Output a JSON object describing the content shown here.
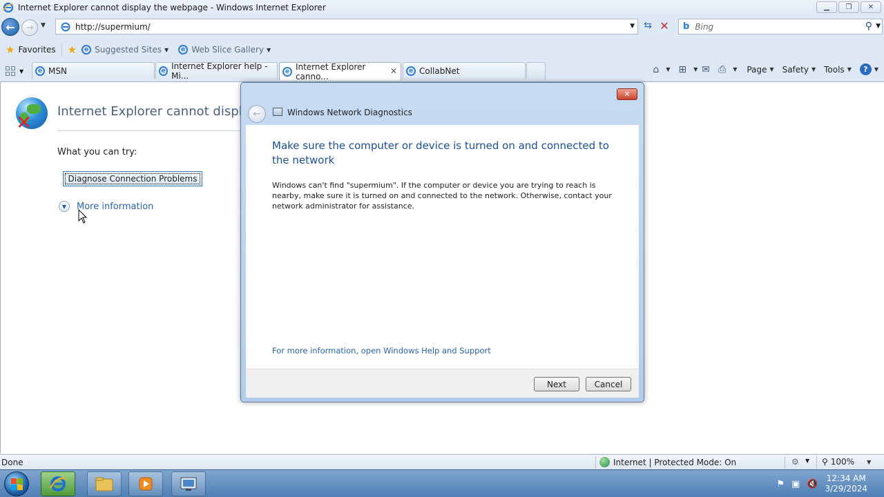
{
  "window": {
    "title": "Internet Explorer cannot display the webpage - Windows Internet Explorer"
  },
  "address": {
    "url": "http://supermium/"
  },
  "search": {
    "placeholder": "Bing"
  },
  "favorites_bar": {
    "favorites_label": "Favorites",
    "suggested_sites": "Suggested Sites",
    "web_slice_gallery": "Web Slice Gallery"
  },
  "tabs": [
    {
      "label": "MSN"
    },
    {
      "label": "Internet Explorer help - Mi..."
    },
    {
      "label": "Internet Explorer canno..."
    },
    {
      "label": "CollabNet"
    }
  ],
  "command_bar": {
    "page": "Page",
    "safety": "Safety",
    "tools": "Tools"
  },
  "page": {
    "title": "Internet Explorer cannot display th",
    "try_label": "What you can try:",
    "diagnose_button": "Diagnose Connection Problems",
    "more_info": "More information"
  },
  "dialog": {
    "title": "Windows Network Diagnostics",
    "heading": "Make sure the computer or device is turned on and connected to the network",
    "message": "Windows can't find \"supermium\". If the computer or device you are trying to reach is nearby, make sure it is turned on and connected to the network. Otherwise, contact your network administrator for assistance.",
    "help_link": "For more information, open Windows Help and Support",
    "next_button": "Next",
    "cancel_button": "Cancel"
  },
  "status": {
    "left": "Done",
    "zone": "Internet | Protected Mode: On",
    "zoom": "100%"
  },
  "clock": {
    "time": "12:34 AM",
    "date": "3/29/2024"
  },
  "colors": {
    "accent": "#1d4f91",
    "link": "#2b63a3",
    "taskbar": "#5d8bbf"
  }
}
